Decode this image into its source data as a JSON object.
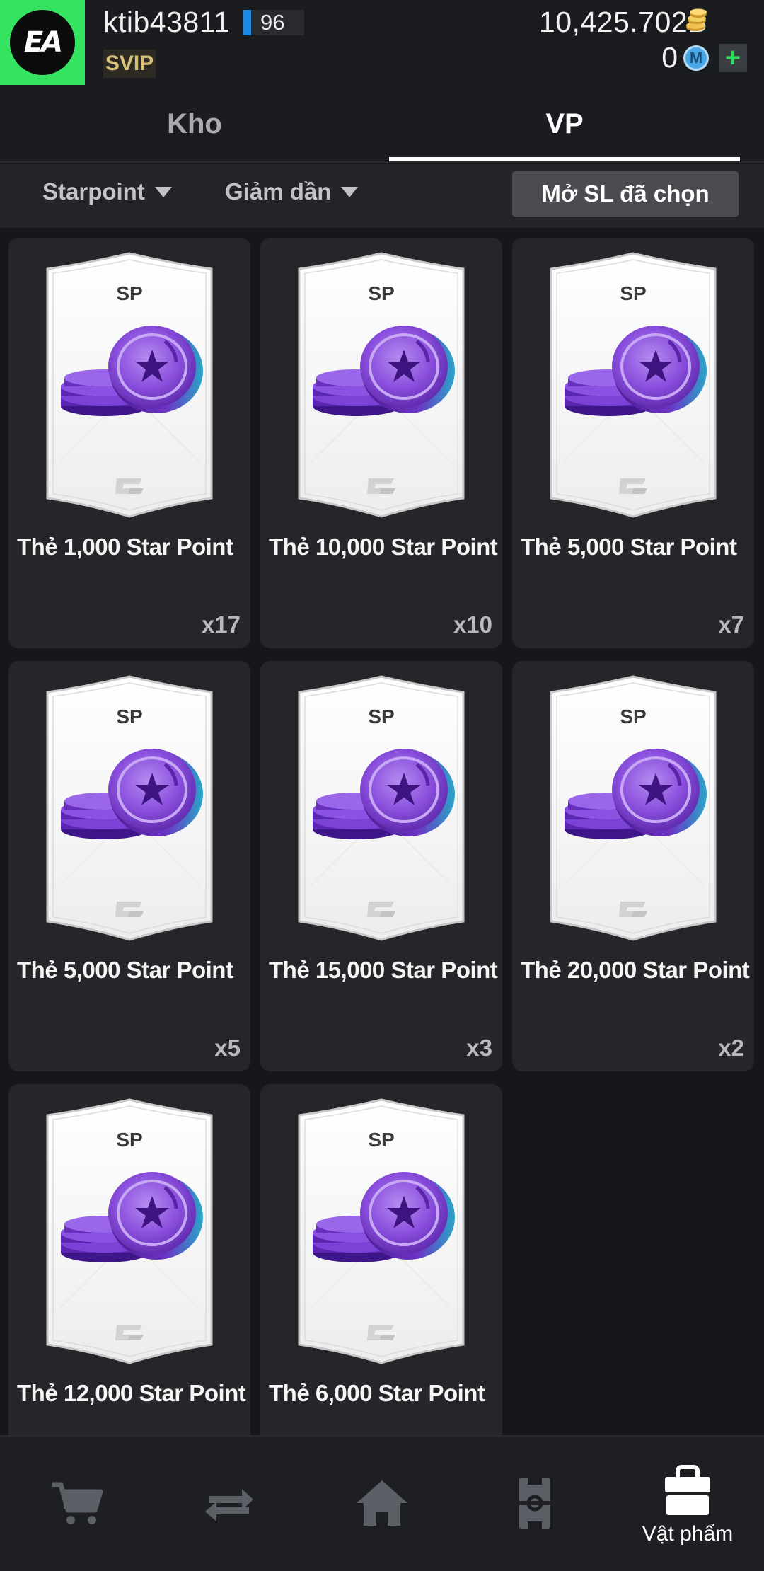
{
  "header": {
    "logo_text": "EA",
    "username": "ktib43811",
    "level": "96",
    "vip": "SVIP",
    "coins": "10,425.702B",
    "mpoints": "0",
    "m_icon_letter": "M",
    "plus_label": "+"
  },
  "tabs": [
    {
      "label": "Kho",
      "active": false
    },
    {
      "label": "VP",
      "active": true
    }
  ],
  "filters": {
    "category": "Starpoint",
    "order": "Giảm dần",
    "open_selected_label": "Mở SL đã chọn"
  },
  "card_label": "SP",
  "items": [
    {
      "name": "Thẻ 1,000 Star Point",
      "qty": "x17"
    },
    {
      "name": "Thẻ 10,000 Star Point",
      "qty": "x10"
    },
    {
      "name": "Thẻ 5,000 Star Point",
      "qty": "x7"
    },
    {
      "name": "Thẻ 5,000 Star Point",
      "qty": "x5"
    },
    {
      "name": "Thẻ 15,000 Star Point",
      "qty": "x3"
    },
    {
      "name": "Thẻ 20,000 Star Point",
      "qty": "x2"
    },
    {
      "name": "Thẻ 12,000 Star Point",
      "qty": ""
    },
    {
      "name": "Thẻ 6,000 Star Point",
      "qty": ""
    }
  ],
  "bottom_nav": [
    {
      "icon": "cart-icon",
      "label": "",
      "active": false
    },
    {
      "icon": "transfer-icon",
      "label": "",
      "active": false
    },
    {
      "icon": "home-icon",
      "label": "",
      "active": false
    },
    {
      "icon": "pitch-icon",
      "label": "",
      "active": false
    },
    {
      "icon": "bag-icon",
      "label": "Vật phẩm",
      "active": true
    }
  ],
  "colors": {
    "logo_bg": "#34e35f",
    "level_bar": "#1e88e5",
    "plus": "#2fdb5a",
    "coin_purple": "#7b3fd1"
  }
}
